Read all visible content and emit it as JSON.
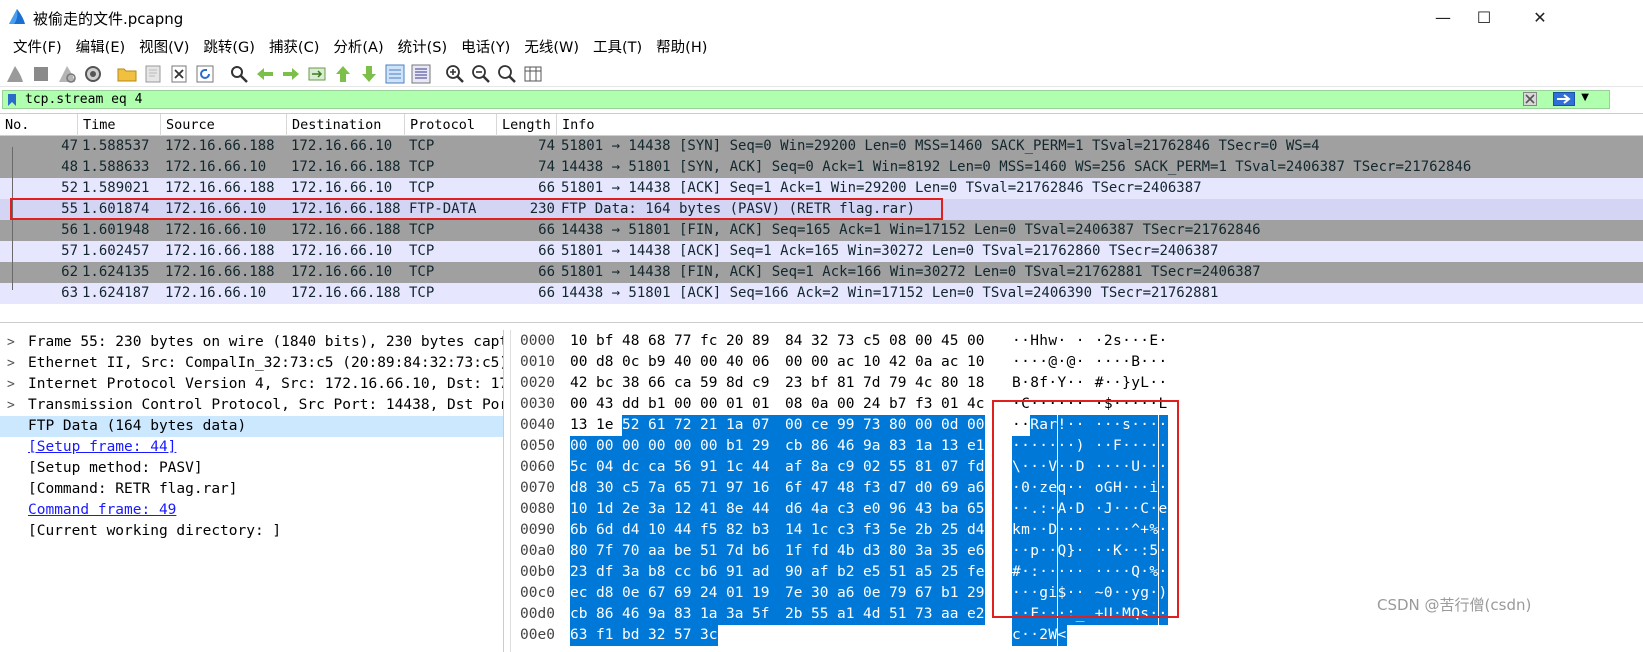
{
  "window": {
    "title": "被偷走的文件.pcapng",
    "minimize": "—",
    "maximize": "☐",
    "close": "✕"
  },
  "menu": [
    "文件(F)",
    "编辑(E)",
    "视图(V)",
    "跳转(G)",
    "捕获(C)",
    "分析(A)",
    "统计(S)",
    "电话(Y)",
    "无线(W)",
    "工具(T)",
    "帮助(H)"
  ],
  "toolbar": {
    "icons": [
      "start-capture-icon",
      "stop-capture-icon",
      "restart-capture-icon",
      "capture-options-icon",
      "open-file-icon",
      "save-file-icon",
      "close-file-icon",
      "reload-icon",
      "find-packet-icon",
      "go-back-icon",
      "go-forward-icon",
      "go-to-packet-icon",
      "first-packet-icon",
      "last-packet-icon",
      "autoscroll-icon",
      "colorize-icon",
      "zoom-in-icon",
      "zoom-out-icon",
      "normal-size-icon",
      "resize-columns-icon"
    ]
  },
  "filter": {
    "value": "tcp.stream eq 4",
    "add_label": "+"
  },
  "colors": {
    "filter_bg": "#afffaf",
    "row_grey": "#a0a0a0",
    "row_lavender": "#e7e6ff",
    "row_selected": "#d4d4f4",
    "bytes_highlight": "#0078d7",
    "annotation_red": "#e0201e"
  },
  "packet_list": {
    "columns": [
      "No.",
      "Time",
      "Source",
      "Destination",
      "Protocol",
      "Length",
      "Info"
    ],
    "rows": [
      {
        "no": "47",
        "time": "1.588537",
        "src": "172.16.66.188",
        "dst": "172.16.66.10",
        "proto": "TCP",
        "len": "74",
        "info": "51801 → 14438 [SYN] Seq=0 Win=29200 Len=0 MSS=1460 SACK_PERM=1 TSval=21762846 TSecr=0 WS=4",
        "style": "grey"
      },
      {
        "no": "48",
        "time": "1.588633",
        "src": "172.16.66.10",
        "dst": "172.16.66.188",
        "proto": "TCP",
        "len": "74",
        "info": "14438 → 51801 [SYN, ACK] Seq=0 Ack=1 Win=8192 Len=0 MSS=1460 WS=256 SACK_PERM=1 TSval=2406387 TSecr=21762846",
        "style": "grey"
      },
      {
        "no": "52",
        "time": "1.589021",
        "src": "172.16.66.188",
        "dst": "172.16.66.10",
        "proto": "TCP",
        "len": "66",
        "info": "51801 → 14438 [ACK] Seq=1 Ack=1 Win=29200 Len=0 TSval=21762846 TSecr=2406387",
        "style": "lav"
      },
      {
        "no": "55",
        "time": "1.601874",
        "src": "172.16.66.10",
        "dst": "172.16.66.188",
        "proto": "FTP-DATA",
        "len": "230",
        "info": "FTP Data: 164 bytes (PASV) (RETR flag.rar)",
        "style": "sel"
      },
      {
        "no": "56",
        "time": "1.601948",
        "src": "172.16.66.10",
        "dst": "172.16.66.188",
        "proto": "TCP",
        "len": "66",
        "info": "14438 → 51801 [FIN, ACK] Seq=165 Ack=1 Win=17152 Len=0 TSval=2406387 TSecr=21762846",
        "style": "grey"
      },
      {
        "no": "57",
        "time": "1.602457",
        "src": "172.16.66.188",
        "dst": "172.16.66.10",
        "proto": "TCP",
        "len": "66",
        "info": "51801 → 14438 [ACK] Seq=1 Ack=165 Win=30272 Len=0 TSval=21762860 TSecr=2406387",
        "style": "lav"
      },
      {
        "no": "62",
        "time": "1.624135",
        "src": "172.16.66.188",
        "dst": "172.16.66.10",
        "proto": "TCP",
        "len": "66",
        "info": "51801 → 14438 [FIN, ACK] Seq=1 Ack=166 Win=30272 Len=0 TSval=21762881 TSecr=2406387",
        "style": "grey"
      },
      {
        "no": "63",
        "time": "1.624187",
        "src": "172.16.66.10",
        "dst": "172.16.66.188",
        "proto": "TCP",
        "len": "66",
        "info": "14438 → 51801 [ACK] Seq=166 Ack=2 Win=17152 Len=0 TSval=2406390 TSecr=21762881",
        "style": "lav"
      }
    ]
  },
  "details": [
    {
      "arrow": ">",
      "text": "Frame 55: 230 bytes on wire (1840 bits), 230 bytes captu",
      "kind": "normal"
    },
    {
      "arrow": ">",
      "text": "Ethernet II, Src: CompalIn_32:73:c5 (20:89:84:32:73:c5),",
      "kind": "normal"
    },
    {
      "arrow": ">",
      "text": "Internet Protocol Version 4, Src: 172.16.66.10, Dst: 172",
      "kind": "normal"
    },
    {
      "arrow": ">",
      "text": "Transmission Control Protocol, Src Port: 14438, Dst Port",
      "kind": "normal"
    },
    {
      "arrow": "",
      "text": "FTP Data (164 bytes data)",
      "kind": "selected"
    },
    {
      "arrow": "",
      "text": "[Setup frame: 44]",
      "kind": "link"
    },
    {
      "arrow": "",
      "text": "[Setup method: PASV]",
      "kind": "normal"
    },
    {
      "arrow": "",
      "text": "[Command: RETR flag.rar]",
      "kind": "normal"
    },
    {
      "arrow": "",
      "text": "Command frame: 49",
      "kind": "link"
    },
    {
      "arrow": "",
      "text": "[Current working directory: ]",
      "kind": "normal"
    }
  ],
  "bytes": [
    {
      "off": "0000",
      "hex": [
        "10",
        "bf",
        "48",
        "68",
        "77",
        "fc",
        "20",
        "89",
        "84",
        "32",
        "73",
        "c5",
        "08",
        "00",
        "45",
        "00"
      ],
      "ascii": "··Hhw· ··2s···E·",
      "hl_from": 16
    },
    {
      "off": "0010",
      "hex": [
        "00",
        "d8",
        "0c",
        "b9",
        "40",
        "00",
        "40",
        "06",
        "00",
        "00",
        "ac",
        "10",
        "42",
        "0a",
        "ac",
        "10"
      ],
      "ascii": "····@·@·····B···",
      "hl_from": 16
    },
    {
      "off": "0020",
      "hex": [
        "42",
        "bc",
        "38",
        "66",
        "ca",
        "59",
        "8d",
        "c9",
        "23",
        "bf",
        "81",
        "7d",
        "79",
        "4c",
        "80",
        "18"
      ],
      "ascii": "B·8f·Y··#··}yL··",
      "hl_from": 16
    },
    {
      "off": "0030",
      "hex": [
        "00",
        "43",
        "dd",
        "b1",
        "00",
        "00",
        "01",
        "01",
        "08",
        "0a",
        "00",
        "24",
        "b7",
        "f3",
        "01",
        "4c"
      ],
      "ascii": "·C·······$·····L",
      "hl_from": 16
    },
    {
      "off": "0040",
      "hex": [
        "13",
        "1e",
        "52",
        "61",
        "72",
        "21",
        "1a",
        "07",
        "00",
        "ce",
        "99",
        "73",
        "80",
        "00",
        "0d",
        "00"
      ],
      "ascii": "··Rar!·····s····",
      "hl_from": 2
    },
    {
      "off": "0050",
      "hex": [
        "00",
        "00",
        "00",
        "00",
        "00",
        "00",
        "b1",
        "29",
        "cb",
        "86",
        "46",
        "9a",
        "83",
        "1a",
        "13",
        "e1"
      ],
      "ascii": "·······)··F·····",
      "hl_from": 0
    },
    {
      "off": "0060",
      "hex": [
        "5c",
        "04",
        "dc",
        "ca",
        "56",
        "91",
        "1c",
        "44",
        "af",
        "8a",
        "c9",
        "02",
        "55",
        "81",
        "07",
        "fd"
      ],
      "ascii": "\\···V··D····U···",
      "hl_from": 0
    },
    {
      "off": "0070",
      "hex": [
        "d8",
        "30",
        "c5",
        "7a",
        "65",
        "71",
        "97",
        "16",
        "6f",
        "47",
        "48",
        "f3",
        "d7",
        "d0",
        "69",
        "a6"
      ],
      "ascii": "·0·zeq··oGH···i·",
      "hl_from": 0
    },
    {
      "off": "0080",
      "hex": [
        "10",
        "1d",
        "2e",
        "3a",
        "12",
        "41",
        "8e",
        "44",
        "d6",
        "4a",
        "c3",
        "e0",
        "96",
        "43",
        "ba",
        "65"
      ],
      "ascii": "··.:·A·D·J···C·e",
      "hl_from": 0
    },
    {
      "off": "0090",
      "hex": [
        "6b",
        "6d",
        "d4",
        "10",
        "44",
        "f5",
        "82",
        "b3",
        "14",
        "1c",
        "c3",
        "f3",
        "5e",
        "2b",
        "25",
        "d4"
      ],
      "ascii": "km··D·······^+%·",
      "hl_from": 0
    },
    {
      "off": "00a0",
      "hex": [
        "80",
        "7f",
        "70",
        "aa",
        "be",
        "51",
        "7d",
        "b6",
        "1f",
        "fd",
        "4b",
        "d3",
        "80",
        "3a",
        "35",
        "e6"
      ],
      "ascii": "··p··Q}···K··:5·",
      "hl_from": 0
    },
    {
      "off": "00b0",
      "hex": [
        "23",
        "df",
        "3a",
        "b8",
        "cc",
        "b6",
        "91",
        "ad",
        "90",
        "af",
        "b2",
        "e5",
        "51",
        "a5",
        "25",
        "fe"
      ],
      "ascii": "#·:·········Q·%·",
      "hl_from": 0
    },
    {
      "off": "00c0",
      "hex": [
        "ec",
        "d8",
        "0e",
        "67",
        "69",
        "24",
        "01",
        "19",
        "7e",
        "30",
        "a6",
        "0e",
        "79",
        "67",
        "b1",
        "29"
      ],
      "ascii": "···gi$··~0··yg·)",
      "hl_from": 0
    },
    {
      "off": "00d0",
      "hex": [
        "cb",
        "86",
        "46",
        "9a",
        "83",
        "1a",
        "3a",
        "5f",
        "2b",
        "55",
        "a1",
        "4d",
        "51",
        "73",
        "aa",
        "e2"
      ],
      "ascii": "··F···:_+U·MQs··",
      "hl_from": 0
    },
    {
      "off": "00e0",
      "hex": [
        "63",
        "f1",
        "bd",
        "32",
        "57",
        "3c"
      ],
      "ascii": "c··2W<",
      "hl_from": 0
    }
  ],
  "watermark": "CSDN @苦行僧(csdn)"
}
